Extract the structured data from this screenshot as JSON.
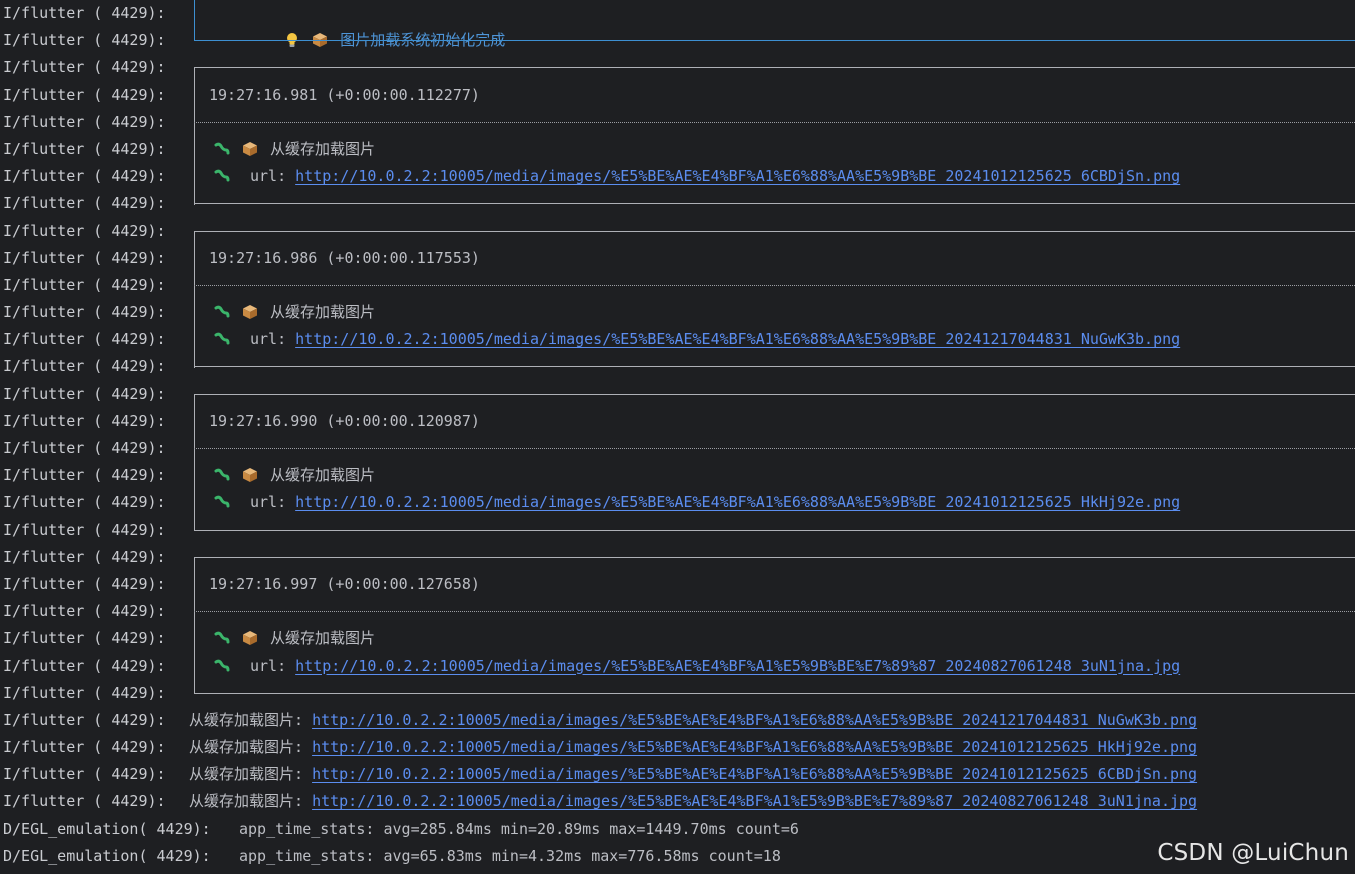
{
  "flutter_prefix": "I/flutter ( 4429):",
  "egl_prefix": "D/EGL_emulation( 4429):",
  "init": {
    "message": "图片加载系统初始化完成"
  },
  "entries": [
    {
      "timestamp": "19:27:16.981 (+0:00:00.112277)",
      "message": "从缓存加载图片",
      "url_label": "url: ",
      "url": "http://10.0.2.2:10005/media/images/%E5%BE%AE%E4%BF%A1%E6%88%AA%E5%9B%BE_20241012125625_6CBDjSn.png"
    },
    {
      "timestamp": "19:27:16.986 (+0:00:00.117553)",
      "message": "从缓存加载图片",
      "url_label": "url: ",
      "url": "http://10.0.2.2:10005/media/images/%E5%BE%AE%E4%BF%A1%E6%88%AA%E5%9B%BE_20241217044831_NuGwK3b.png"
    },
    {
      "timestamp": "19:27:16.990 (+0:00:00.120987)",
      "message": "从缓存加载图片",
      "url_label": "url: ",
      "url": "http://10.0.2.2:10005/media/images/%E5%BE%AE%E4%BF%A1%E6%88%AA%E5%9B%BE_20241012125625_HkHj92e.png"
    },
    {
      "timestamp": "19:27:16.997 (+0:00:00.127658)",
      "message": "从缓存加载图片",
      "url_label": "url: ",
      "url": "http://10.0.2.2:10005/media/images/%E5%BE%AE%E4%BF%A1%E5%9B%BE%E7%89%87_20240827061248_3uN1jna.jpg"
    }
  ],
  "plain_logs": [
    {
      "label": "从缓存加载图片: ",
      "url": "http://10.0.2.2:10005/media/images/%E5%BE%AE%E4%BF%A1%E6%88%AA%E5%9B%BE_20241217044831_NuGwK3b.png"
    },
    {
      "label": "从缓存加载图片: ",
      "url": "http://10.0.2.2:10005/media/images/%E5%BE%AE%E4%BF%A1%E6%88%AA%E5%9B%BE_20241012125625_HkHj92e.png"
    },
    {
      "label": "从缓存加载图片: ",
      "url": "http://10.0.2.2:10005/media/images/%E5%BE%AE%E4%BF%A1%E6%88%AA%E5%9B%BE_20241012125625_6CBDjSn.png"
    },
    {
      "label": "从缓存加载图片: ",
      "url": "http://10.0.2.2:10005/media/images/%E5%BE%AE%E4%BF%A1%E5%9B%BE%E7%89%87_20240827061248_3uN1jna.jpg"
    }
  ],
  "egl_logs": [
    "app_time_stats: avg=285.84ms min=20.89ms max=1449.70ms count=6",
    "app_time_stats: avg=65.83ms min=4.32ms max=776.58ms count=18"
  ],
  "watermark": "CSDN @LuiChun",
  "icons": {
    "bulb": "lightbulb-icon",
    "package": "package-icon",
    "worm": "worm-icon"
  },
  "colors": {
    "background": "#1e1f22",
    "text": "#bcbec4",
    "link": "#5b8def",
    "init_accent": "#3d8fd1"
  }
}
